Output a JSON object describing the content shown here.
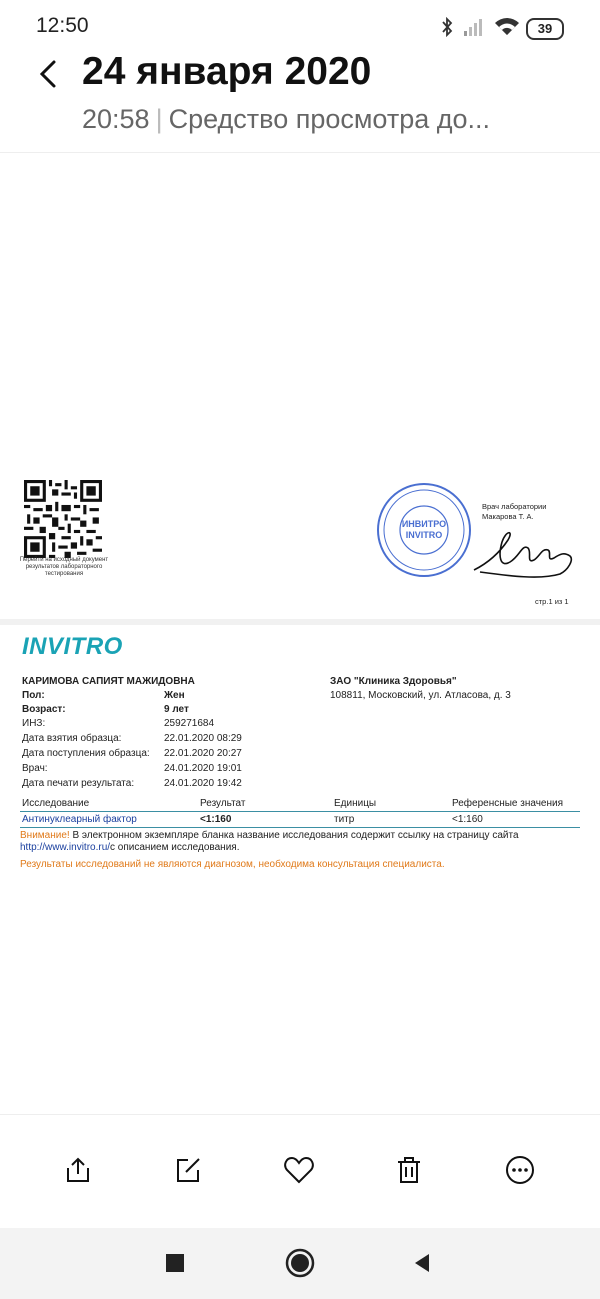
{
  "status_bar": {
    "time": "12:50",
    "battery": "39",
    "icons": [
      "bluetooth-icon",
      "signal-icon",
      "wifi-icon",
      "battery-icon"
    ]
  },
  "header": {
    "title": "24 января 2020",
    "time": "20:58",
    "app": "Средство просмотра до..."
  },
  "page1": {
    "qr_caption": "Перейти на исходный документ результатов лабораторного тестирования",
    "stamp_text": [
      "ИНВИТРО",
      "INVITRO"
    ],
    "doctor_title": "Врач лаборатории",
    "doctor_name": "Макарова Т. А.",
    "page_number": "стр.1 из 1"
  },
  "page2": {
    "logo": "INVITRO",
    "patient_name": "КАРИМОВА САПИЯТ МАЖИДОВНА",
    "fields": [
      {
        "label": "Пол:",
        "value": "Жен",
        "bold": true
      },
      {
        "label": "Возраст:",
        "value": "9 лет",
        "bold": true
      },
      {
        "label": "ИНЗ:",
        "value": "259271684",
        "bold": false
      },
      {
        "label": "Дата взятия образца:",
        "value": "22.01.2020 08:29",
        "bold": false
      },
      {
        "label": "Дата поступления образца:",
        "value": "22.01.2020 20:27",
        "bold": false
      },
      {
        "label": "Врач:",
        "value": "24.01.2020 19:01",
        "bold": false
      },
      {
        "label": "Дата печати результата:",
        "value": "24.01.2020 19:42",
        "bold": false
      }
    ],
    "clinic_name": "ЗАО \"Клиника Здоровья\"",
    "clinic_address": "108811, Московский, ул. Атласова, д. 3",
    "table_headers": [
      "Исследование",
      "Результат",
      "Единицы",
      "Референсные значения"
    ],
    "table_rows": [
      {
        "test": "Антинуклеарный фактор",
        "result": "<1:160",
        "units": "титр",
        "reference": "<1:160"
      }
    ],
    "note_warning": "Внимание!",
    "note_text": " В электронном экземпляре бланка название исследования содержит ссылку на страницу сайта",
    "note_link": "http://www.invitro.ru/",
    "note_text2": "с описанием исследования.",
    "disclaimer": "Результаты исследований не являются диагнозом, необходима консультация специалиста."
  },
  "toolbar": [
    "share-icon",
    "edit-icon",
    "heart-icon",
    "delete-icon",
    "more-icon"
  ],
  "navbar": [
    "recents-icon",
    "home-icon",
    "back-icon"
  ]
}
